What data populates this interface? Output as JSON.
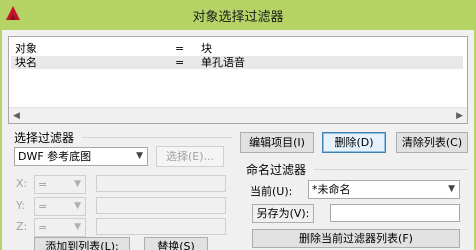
{
  "window": {
    "title": "对象选择过滤器"
  },
  "filter_list": {
    "rows": [
      {
        "key": "对象",
        "op": "=",
        "value": "块",
        "selected": false
      },
      {
        "key": "块名",
        "op": "=",
        "value": "单孔语音",
        "selected": true
      }
    ]
  },
  "select_filter": {
    "group_label": "选择过滤器",
    "type_value": "DWF 参考底图",
    "select_button": "选择(E)...",
    "x_label": "X:",
    "y_label": "Y:",
    "z_label": "Z:",
    "op_value": "=",
    "add_button": "添加到列表(L):",
    "replace_button": "替换(S)"
  },
  "actions": {
    "edit_button": "编辑项目(I)",
    "delete_button": "删除(D)",
    "clear_button": "清除列表(C)"
  },
  "named_filter": {
    "group_label": "命名过滤器",
    "current_label": "当前(U):",
    "current_value": "*未命名",
    "save_as_button": "另存为(V):",
    "save_as_value": "",
    "delete_current_button": "删除当前过滤器列表(F)"
  },
  "colors": {
    "titlebar": "#b6d466",
    "selection": "#e8e8e8",
    "default_border": "#3c7fb1"
  }
}
